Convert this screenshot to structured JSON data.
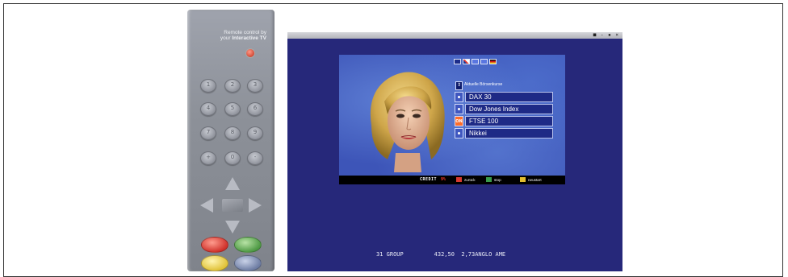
{
  "remote": {
    "caption_line1": "Remote control by",
    "caption_line2_prefix": "your",
    "caption_line2_brand": "Interactive TV",
    "number_buttons": [
      "1",
      "2",
      "3",
      "4",
      "5",
      "6",
      "7",
      "8",
      "9",
      "+",
      "0",
      "-"
    ],
    "color_buttons": [
      "red",
      "green",
      "yellow",
      "blue"
    ]
  },
  "tv": {
    "window_icons": "■ - ▪ ×",
    "menu": {
      "title": "Aktuelle Börsenkurse",
      "items": [
        {
          "label": "DAX 30",
          "active": false
        },
        {
          "label": "Dow Jones Index",
          "active": false
        },
        {
          "label": "FTSE 100",
          "active": true,
          "badge": "ON"
        },
        {
          "label": "Nikkei",
          "active": false
        }
      ]
    },
    "ticker_top_label": "CREDIT",
    "ticker_top_value": "9%",
    "controls": {
      "back": "zurück",
      "stop": "stop",
      "restart": "neustart"
    },
    "bottom_ticker": "31 GROUP         432,50  2,73ANGLO AME"
  },
  "colors": {
    "tv_background": "#26287a",
    "panel_background": "#3d55b8",
    "active_bullet": "#ff6d2a"
  }
}
